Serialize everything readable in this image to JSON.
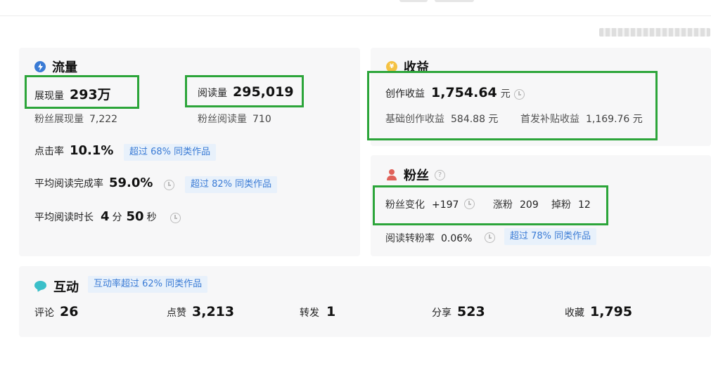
{
  "flow": {
    "title": "流量",
    "impressions_label": "展现量",
    "impressions_value": "293万",
    "reads_label": "阅读量",
    "reads_value": "295,019",
    "fan_impressions_label": "粉丝展现量",
    "fan_impressions_value": "7,222",
    "fan_reads_label": "粉丝阅读量",
    "fan_reads_value": "710",
    "ctr_label": "点击率",
    "ctr_value": "10.1%",
    "ctr_badge": "超过 68% 同类作品",
    "completion_label": "平均阅读完成率",
    "completion_value": "59.0%",
    "completion_badge": "超过 82% 同类作品",
    "duration_label": "平均阅读时长",
    "duration_min": "4",
    "duration_min_unit": "分",
    "duration_sec": "50",
    "duration_sec_unit": "秒"
  },
  "income": {
    "title": "收益",
    "creation_label": "创作收益",
    "creation_value": "1,754.64",
    "currency": "元",
    "base_label": "基础创作收益",
    "base_value": "584.88 元",
    "bonus_label": "首发补贴收益",
    "bonus_value": "1,169.76 元"
  },
  "fans": {
    "title": "粉丝",
    "change_label": "粉丝变化",
    "change_value": "+197",
    "gain_label": "涨粉",
    "gain_value": "209",
    "loss_label": "掉粉",
    "loss_value": "12",
    "conversion_label": "阅读转粉率",
    "conversion_value": "0.06%",
    "conversion_badge": "超过 78% 同类作品"
  },
  "interaction": {
    "title": "互动",
    "badge": "互动率超过 62% 同类作品",
    "comments_label": "评论",
    "comments_value": "26",
    "likes_label": "点赞",
    "likes_value": "3,213",
    "shares_label": "转发",
    "shares_value": "1",
    "shares2_label": "分享",
    "shares2_value": "523",
    "favorites_label": "收藏",
    "favorites_value": "1,795"
  },
  "colors": {
    "highlight_box": "#2ca53a",
    "flow_icon": "#3a7bd5",
    "income_icon": "#f5c243",
    "fans_icon": "#e0625a",
    "interaction_icon": "#3bbfc9",
    "badge_text": "#3a7bd5"
  },
  "icons": {
    "flow": "lightning-icon",
    "income": "coin-icon",
    "fans": "person-icon",
    "interaction": "chat-bubble-icon",
    "history": "clock-icon",
    "help": "question-icon"
  }
}
